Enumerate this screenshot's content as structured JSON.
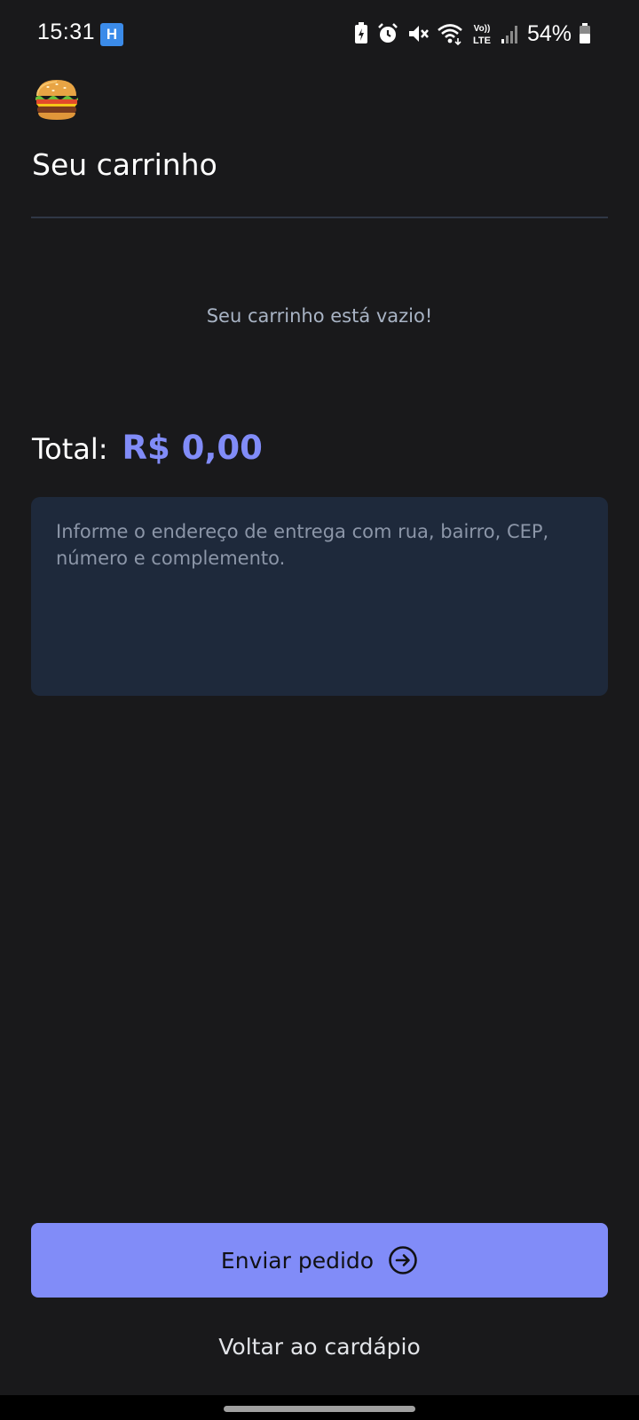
{
  "status_bar": {
    "time": "15:31",
    "app_badge": "H",
    "lte_top": "Vo))",
    "lte_bottom": "LTE",
    "battery_percent": "54%"
  },
  "header": {
    "logo_icon": "burger-icon",
    "title": "Seu carrinho"
  },
  "cart": {
    "empty_message": "Seu carrinho está vazio!",
    "total_label": "Total:",
    "total_value": "R$ 0,00"
  },
  "address": {
    "value": "",
    "placeholder": "Informe o endereço de entrega com rua, bairro, CEP, número e complemento."
  },
  "actions": {
    "send_label": "Enviar pedido",
    "send_icon": "arrow-right-circle-icon",
    "back_label": "Voltar ao cardápio"
  },
  "colors": {
    "background": "#19191b",
    "accent": "#818cf8",
    "input_background": "#1e293b",
    "divider": "#2f3746"
  }
}
